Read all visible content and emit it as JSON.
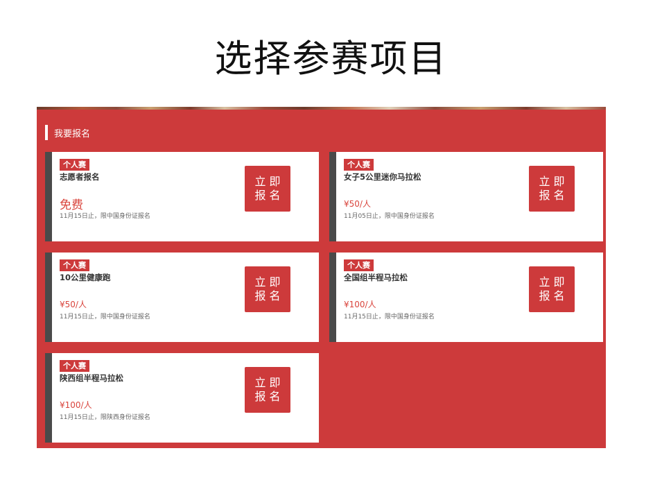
{
  "page": {
    "title": "选择参赛项目"
  },
  "section": {
    "title": "我要报名"
  },
  "colors": {
    "panel_red": "#cd3a3b",
    "card_bar": "#4a4a4a",
    "price_red": "#d9443c"
  },
  "cards": [
    {
      "badge": "个人赛",
      "name": "志愿者报名",
      "price": "免费",
      "note": "11月15日止，限中国身份证报名",
      "button_line1": "立即",
      "button_line2": "报名"
    },
    {
      "badge": "个人赛",
      "name": "女子5公里迷你马拉松",
      "price": "¥50/人",
      "note": "11月05日止，限中国身份证报名",
      "button_line1": "立即",
      "button_line2": "报名"
    },
    {
      "badge": "个人赛",
      "name": "10公里健康跑",
      "price": "¥50/人",
      "note": "11月15日止，限中国身份证报名",
      "button_line1": "立即",
      "button_line2": "报名"
    },
    {
      "badge": "个人赛",
      "name": "全国组半程马拉松",
      "price": "¥100/人",
      "note": "11月15日止，限中国身份证报名",
      "button_line1": "立即",
      "button_line2": "报名"
    },
    {
      "badge": "个人赛",
      "name": "陕西组半程马拉松",
      "price": "¥100/人",
      "note": "11月15日止，限陕西身份证报名",
      "button_line1": "立即",
      "button_line2": "报名"
    }
  ]
}
